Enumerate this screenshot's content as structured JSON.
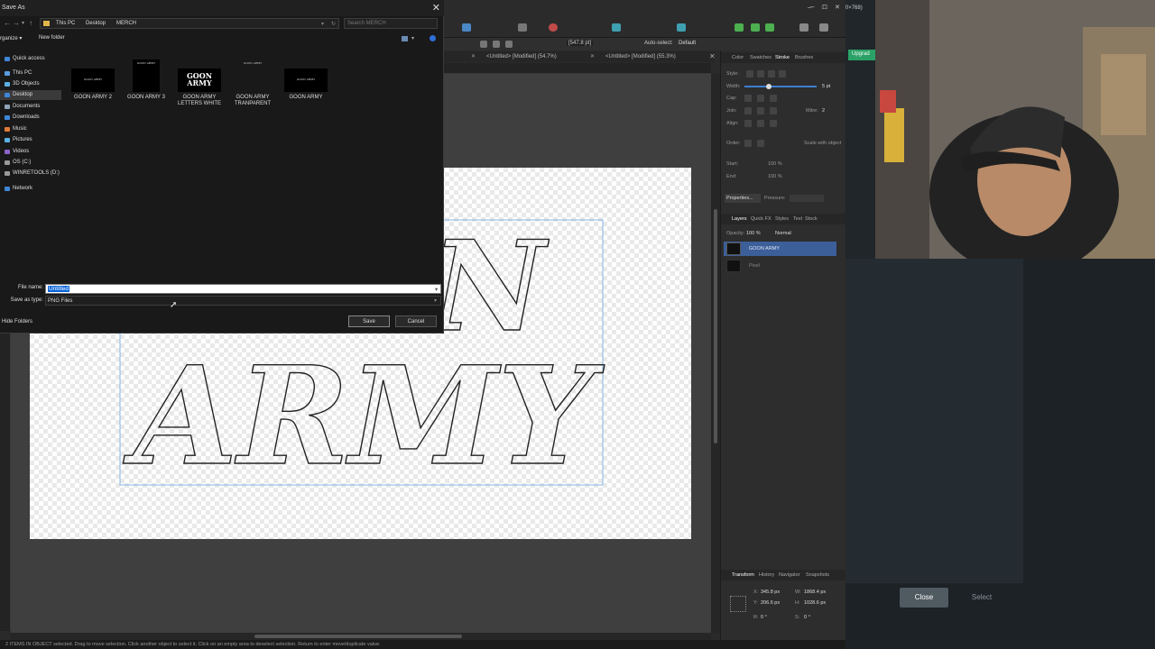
{
  "dialog": {
    "title": "Save As",
    "close_glyph": "✕",
    "address": [
      "This PC",
      "Desktop",
      "MERCH"
    ],
    "search_placeholder": "Search MERCH",
    "organize": "rganize ▾",
    "new_folder": "New folder",
    "nav": [
      {
        "label": "Quick access",
        "icon": "star-icon"
      },
      {
        "label": "This PC",
        "icon": "pc-icon"
      },
      {
        "label": "3D Objects",
        "icon": "objects-icon"
      },
      {
        "label": "Desktop",
        "icon": "desktop-icon"
      },
      {
        "label": "Documents",
        "icon": "documents-icon"
      },
      {
        "label": "Downloads",
        "icon": "download-icon"
      },
      {
        "label": "Music",
        "icon": "music-icon"
      },
      {
        "label": "Pictures",
        "icon": "pictures-icon"
      },
      {
        "label": "Videos",
        "icon": "videos-icon"
      },
      {
        "label": "OS (C:)",
        "icon": "drive-icon"
      },
      {
        "label": "WINRETOOLS (D:)",
        "icon": "drive-icon"
      },
      {
        "label": "Network",
        "icon": "network-icon"
      }
    ],
    "files": [
      {
        "name": "GOON ARMY 2",
        "thumb_text": "GOON ARMY"
      },
      {
        "name": "GOON ARMY 3",
        "thumb_text": "GOON ARMY"
      },
      {
        "name": "GOON ARMY LETTERS WHITE",
        "thumb_text": "GOON ARMY"
      },
      {
        "name": "GOON ARMY TRANPARENT",
        "thumb_text": "GOON ARMY"
      },
      {
        "name": "GOON ARMY",
        "thumb_text": "GOON ARMY"
      }
    ],
    "file_name_label": "File name:",
    "file_name_value": "Untitled",
    "save_type_label": "Save as type:",
    "save_type_value": "PNG Files",
    "hide_folders": "Hide Folders",
    "save": "Save",
    "cancel": "Cancel"
  },
  "app": {
    "tabs": [
      "<Untitled> [Modified] (54.7%)",
      "<Untitled> [Modified] (55.3%)"
    ],
    "ctx": {
      "stroke_value": "[547.8 pt]",
      "auto_select": "Auto-select:",
      "auto_select_value": "Default"
    },
    "artwork_text_top": "ON",
    "artwork_text_bottom": "ARMY",
    "status": "2 ITEMS IN OBJECT selected. Drag to move selection. Click another object to select it. Click on an empty area to deselect selection. Return to enter move/duplicate value."
  },
  "studio": {
    "top_tabs": [
      "Color",
      "Swatches",
      "Stroke",
      "Brushes"
    ],
    "stroke": {
      "style_label": "Style:",
      "width_label": "Width:",
      "width_value": "5 pt",
      "cap_label": "Cap:",
      "join_label": "Join:",
      "mitre_label": "Mitre:",
      "mitre_value": "2",
      "align_label": "Align:",
      "order_label": "Order:",
      "scale_label": "Scale with object",
      "start_label": "Start:",
      "end_label": "End:",
      "start_pct": "100 %",
      "end_pct": "100 %",
      "properties": "Properties...",
      "pressure": "Pressure:"
    },
    "layer_tabs": [
      "Layers",
      "Quick FX",
      "Styles",
      "Text",
      "Stock"
    ],
    "opacity_label": "Opacity:",
    "opacity_value": "100 %",
    "blend_mode": "Normal",
    "layers": [
      {
        "name": "GOON ARMY",
        "selected": true
      },
      {
        "name": "Pixel",
        "selected": false
      }
    ],
    "bottom_tabs": [
      "Transform",
      "History",
      "Navigator",
      "Snapshots"
    ],
    "transform": {
      "x_label": "X:",
      "x": "345.8 px",
      "y_label": "Y:",
      "y": "206.6 px",
      "w_label": "W:",
      "w": "1868.4 px",
      "h_label": "H:",
      "h": "1028.6 px",
      "r_label": "R:",
      "r": "0 °",
      "s_label": "S:",
      "s": "0 °"
    }
  },
  "overlay": {
    "upgrade": "Upgrad",
    "window_text": "0×768)",
    "close": "Close",
    "select": "Select"
  },
  "colors": {
    "accent_blue": "#0a64d8",
    "selected_layer": "#3c5f9a",
    "upgrade_green": "#2aa166"
  }
}
